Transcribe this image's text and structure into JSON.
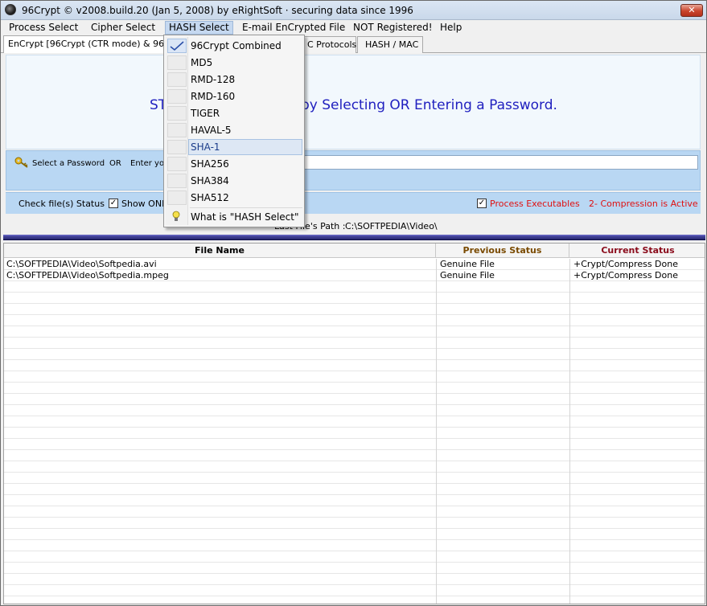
{
  "window": {
    "title": "96Crypt © v2008.build.20 (Jan 5, 2008) by eRightSoft  ·  securing data since 1996",
    "close_label": "✕"
  },
  "menubar": {
    "items": [
      {
        "label": "Process Select"
      },
      {
        "label": "Cipher Select"
      },
      {
        "label": "HASH Select"
      },
      {
        "label": "E-mail EnCrypted File"
      },
      {
        "label": "NOT Registered!"
      },
      {
        "label": "Help"
      }
    ]
  },
  "tabs": [
    {
      "label": "EnCrypt [96Crypt (CTR mode) & 96Crypt"
    },
    {
      "label": "C Protocols"
    },
    {
      "label": "HASH / MAC"
    }
  ],
  "banner": {
    "left_fragment": "ST",
    "right_fragment": "by Selecting OR Entering a Password."
  },
  "password": {
    "select_label": "Select a Password",
    "or_label": "OR",
    "enter_label": "Enter you",
    "value": ""
  },
  "status_row": {
    "check_label": "Check file(s) Status",
    "show_only_label": "Show ONL",
    "process_exec_label": "Process Executables",
    "compression_label": "2- Compression is Active",
    "show_only_checked": true,
    "process_exec_checked": true
  },
  "path": {
    "label": "Last File's Path :",
    "value": "C:\\SOFTPEDIA\\Video\\"
  },
  "table": {
    "columns": [
      "File Name",
      "Previous Status",
      "Current Status"
    ],
    "column_colors": [
      "#000000",
      "#7a4a00",
      "#8a0a1a"
    ],
    "rows": [
      [
        "C:\\SOFTPEDIA\\Video\\Softpedia.avi",
        "Genuine File",
        "+Crypt/Compress Done"
      ],
      [
        "C:\\SOFTPEDIA\\Video\\Softpedia.mpeg",
        "Genuine File",
        "+Crypt/Compress Done"
      ]
    ]
  },
  "hash_menu": {
    "items": [
      {
        "label": "96Crypt Combined",
        "checked": true
      },
      {
        "label": "MD5"
      },
      {
        "label": "RMD-128"
      },
      {
        "label": "RMD-160"
      },
      {
        "label": "TIGER"
      },
      {
        "label": "HAVAL-5"
      },
      {
        "label": "SHA-1",
        "highlighted": true
      },
      {
        "label": "SHA256"
      },
      {
        "label": "SHA384"
      },
      {
        "label": "SHA512"
      }
    ],
    "help_item": {
      "label": "What is \"HASH Select\""
    }
  },
  "colors": {
    "banner_text": "#1f1fbf",
    "accent_panel": "#b9d7f3",
    "red_status": "#e01010"
  }
}
